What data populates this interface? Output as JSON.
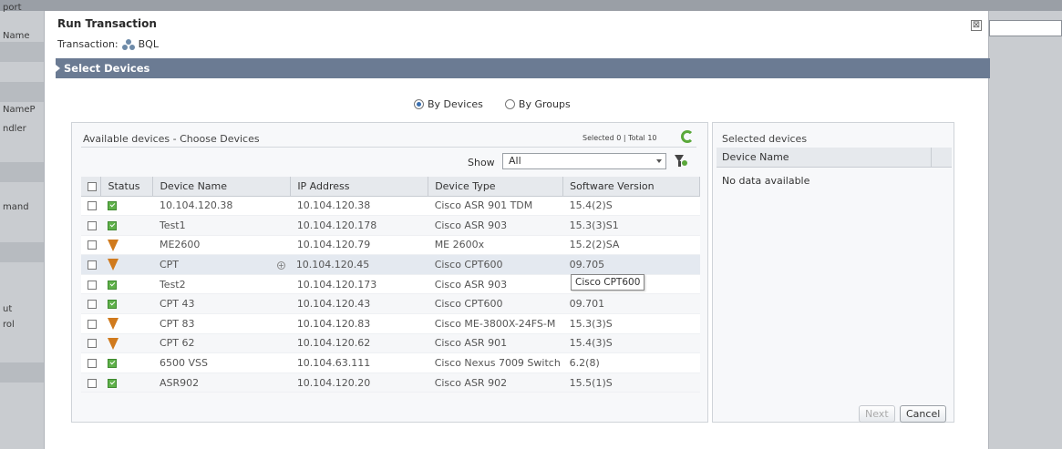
{
  "background": {
    "left_labels": [
      "port",
      "Name",
      "NameP",
      "ndler",
      "mand",
      "ut",
      "rol"
    ]
  },
  "dialog": {
    "title": "Run Transaction",
    "close_glyph": "⊠",
    "transaction_label": "Transaction:",
    "transaction_name": "BQL",
    "section_title": "Select Devices",
    "radio_by_devices": "By Devices",
    "radio_by_groups": "By Groups",
    "selected_mode": "By Devices"
  },
  "available": {
    "title": "Available devices - Choose Devices",
    "selected_count_text": "Selected 0 | Total 10",
    "show_label": "Show",
    "show_value": "All",
    "columns": [
      "Status",
      "Device Name",
      "IP Address",
      "Device Type",
      "Software Version"
    ],
    "rows": [
      {
        "status": "ok",
        "name": "10.104.120.38",
        "ip": "10.104.120.38",
        "type": "Cisco ASR 901 TDM",
        "version": "15.4(2)S"
      },
      {
        "status": "ok",
        "name": "Test1",
        "ip": "10.104.120.178",
        "type": "Cisco ASR 903",
        "version": "15.3(3)S1"
      },
      {
        "status": "warning",
        "name": "ME2600",
        "ip": "10.104.120.79",
        "type": "ME 2600x",
        "version": "15.2(2)SA"
      },
      {
        "status": "warning",
        "name": "CPT",
        "ip": "10.104.120.45",
        "type": "Cisco CPT600",
        "version": "09.705"
      },
      {
        "status": "ok",
        "name": "Test2",
        "ip": "10.104.120.173",
        "type": "Cisco ASR 903",
        "version": ""
      },
      {
        "status": "ok",
        "name": "CPT 43",
        "ip": "10.104.120.43",
        "type": "Cisco CPT600",
        "version": "09.701"
      },
      {
        "status": "warning",
        "name": "CPT 83",
        "ip": "10.104.120.83",
        "type": "Cisco ME-3800X-24FS-M",
        "version": "15.3(3)S"
      },
      {
        "status": "warning",
        "name": "CPT 62",
        "ip": "10.104.120.62",
        "type": "Cisco ASR 901",
        "version": "15.4(3)S"
      },
      {
        "status": "ok",
        "name": "6500 VSS",
        "ip": "10.104.63.111",
        "type": "Cisco Nexus 7009 Switch",
        "version": "6.2(8)"
      },
      {
        "status": "ok",
        "name": "ASR902",
        "ip": "10.104.120.20",
        "type": "Cisco ASR 902",
        "version": "15.5(1)S"
      }
    ],
    "tooltip": "Cisco CPT600"
  },
  "selected": {
    "title": "Selected devices",
    "column": "Device Name",
    "empty_text": "No data available"
  },
  "buttons": {
    "next": "Next",
    "cancel": "Cancel"
  },
  "colors": {
    "section_bar": "#6b7b93",
    "status_ok": "#5fb14a",
    "status_warning": "#d07a1d"
  }
}
